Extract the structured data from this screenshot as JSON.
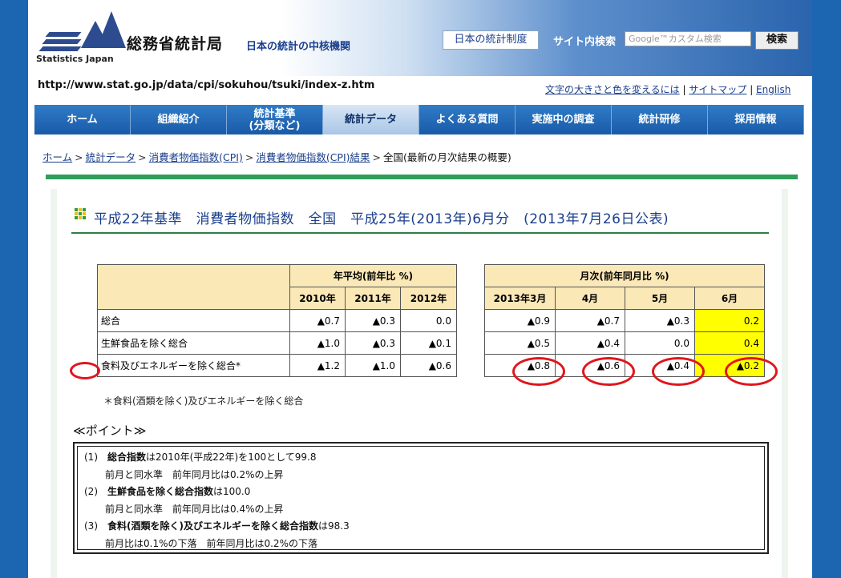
{
  "header": {
    "logo_en": "Statistics Japan",
    "site_title": "総務省統計局",
    "tagline": "日本の統計の中核機関",
    "system_button": "日本の統計制度",
    "search_label": "サイト内検索",
    "search_placeholder": "Google™カスタム検索",
    "search_button": "検索"
  },
  "url": "http://www.stat.go.jp/data/cpi/sokuhou/tsuki/index-z.htm",
  "util_links": {
    "text_size": "文字の大きさと色を変えるには",
    "sitemap": "サイトマップ",
    "english": "English"
  },
  "nav": {
    "items": [
      {
        "label": "ホーム",
        "active": false
      },
      {
        "label": "組織紹介",
        "active": false
      },
      {
        "label": "統計基準\n(分類など)",
        "active": false
      },
      {
        "label": "統計データ",
        "active": true
      },
      {
        "label": "よくある質問",
        "active": false
      },
      {
        "label": "実施中の調査",
        "active": false
      },
      {
        "label": "統計研修",
        "active": false
      },
      {
        "label": "採用情報",
        "active": false
      }
    ]
  },
  "breadcrumb": {
    "items": [
      "ホーム",
      "統計データ",
      "消費者物価指数(CPI)",
      "消費者物価指数(CPI)結果"
    ],
    "current": "全国(最新の月次結果の概要)"
  },
  "page_title": "平成22年基準　消費者物価指数　全国　平成25年(2013年)6月分　(2013年7月26日公表)",
  "annual_table": {
    "group_header": "年平均(前年比 %)",
    "columns": [
      "2010年",
      "2011年",
      "2012年"
    ],
    "rows": [
      {
        "label": "総合",
        "values": [
          "▲0.7",
          "▲0.3",
          "0.0"
        ]
      },
      {
        "label": "生鮮食品を除く総合",
        "values": [
          "▲1.0",
          "▲0.3",
          "▲0.1"
        ]
      },
      {
        "label": "食料及びエネルギーを除く総合*",
        "values": [
          "▲1.2",
          "▲1.0",
          "▲0.6"
        ]
      }
    ]
  },
  "monthly_table": {
    "group_header": "月次(前年同月比 %)",
    "columns": [
      "2013年3月",
      "4月",
      "5月",
      "6月"
    ],
    "rows": [
      {
        "values": [
          "▲0.9",
          "▲0.7",
          "▲0.3",
          "0.2"
        ]
      },
      {
        "values": [
          "▲0.5",
          "▲0.4",
          "0.0",
          "0.4"
        ]
      },
      {
        "values": [
          "▲0.8",
          "▲0.6",
          "▲0.4",
          "▲0.2"
        ]
      }
    ]
  },
  "footnote": "＊食料(酒類を除く)及びエネルギーを除く総合",
  "points": {
    "title": "≪ポイント≫",
    "items": [
      {
        "num": "(1)",
        "name": "総合指数",
        "value_text": "は2010年(平成22年)を100として99.8",
        "detail": "前月と同水準　前年同月比は0.2%の上昇"
      },
      {
        "num": "(2)",
        "name": "生鮮食品を除く総合指数",
        "value_text": "は100.0",
        "detail": "前月と同水準　前年同月比は0.4%の上昇"
      },
      {
        "num": "(3)",
        "name": "食料(酒類を除く)及びエネルギーを除く総合指数",
        "value_text": "は98.3",
        "detail": "前月比は0.1%の下落　前年同月比は0.2%の下落"
      }
    ]
  },
  "colors": {
    "nav_blue": "#1a5aa8",
    "highlight_yellow": "#ffff00",
    "annotation_red": "#e0161c",
    "header_fill": "#fbe8b7"
  }
}
